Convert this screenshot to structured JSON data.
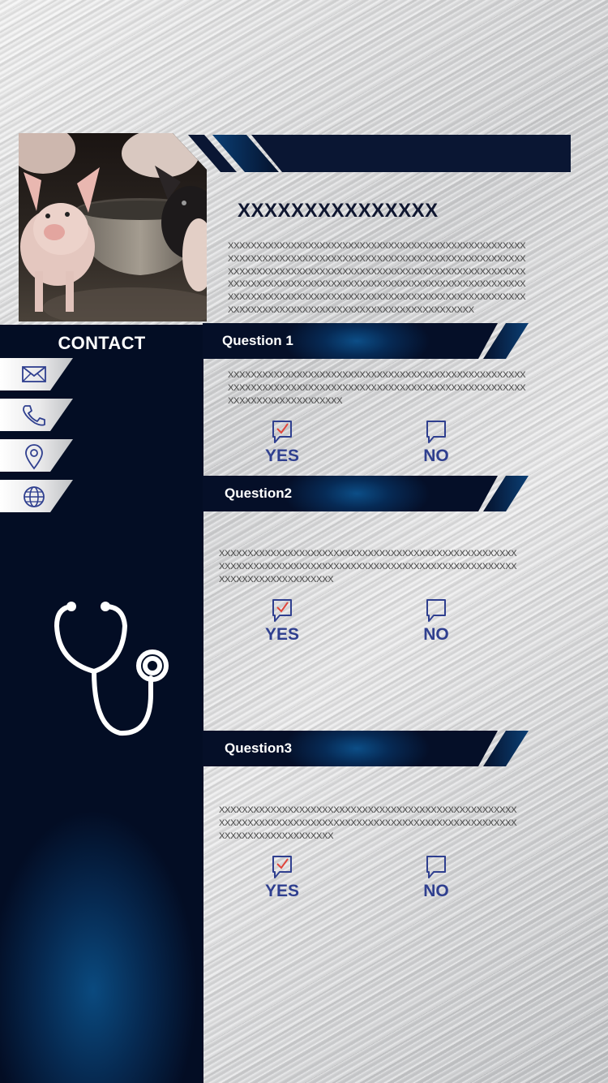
{
  "profile": {
    "name": "XXXXXXXXXXXXXXX",
    "bio": "XXXXXXXXXXXXXXXXXXXXXXXXXXXXXXXXXXXXXXXXXXXXXXXXXXXXXXXXXXXXXXXXXXXXXXXXXXXXXXXXXXXXXXXXXXXXXXXXXXXXXXXXXXXXXXXXXXXXXXXXXXXXXXXXXXXXXXXXXXXXXXXXXXXXXXXXXXXXXXXXXXXXXXXXXXXXXXXXXXXXXXXXXXXXXXXXXXXXXXXXXXXXXXXXXXXXXXXXXXXXXXXXXXXXXXXXXXXXXXXXXXXXXXXXXXXXXXXXXXXXXXXXXXXXXXXXXXXXXXXXXXXXXXXXXXXXXXXXXXXXXXX"
  },
  "contact": {
    "title": "CONTACT",
    "items": [
      {
        "icon": "mail-icon"
      },
      {
        "icon": "phone-icon"
      },
      {
        "icon": "location-icon"
      },
      {
        "icon": "globe-icon"
      }
    ]
  },
  "questions": [
    {
      "label": "Question 1",
      "text": "XXXXXXXXXXXXXXXXXXXXXXXXXXXXXXXXXXXXXXXXXXXXXXXXXXXXXXXXXXXXXXXXXXXXXXXXXXXXXXXXXXXXXXXXXXXXXXXXXXXXXXXXXXXXXXXXXXXXXXXXXXXX",
      "yes": "YES",
      "no": "NO"
    },
    {
      "label": "Question2",
      "text": "XXXXXXXXXXXXXXXXXXXXXXXXXXXXXXXXXXXXXXXXXXXXXXXXXXXXXXXXXXXXXXXXXXXXXXXXXXXXXXXXXXXXXXXXXXXXXXXXXXXXXXXXXXXXXXXXXXXXXXXXXXXX",
      "yes": "YES",
      "no": "NO"
    },
    {
      "label": "Question3",
      "text": "XXXXXXXXXXXXXXXXXXXXXXXXXXXXXXXXXXXXXXXXXXXXXXXXXXXXXXXXXXXXXXXXXXXXXXXXXXXXXXXXXXXXXXXXXXXXXXXXXXXXXXXXXXXXXXXXXXXXXXXXXXXX",
      "yes": "YES",
      "no": "NO"
    }
  ],
  "colors": {
    "navy": "#050f28",
    "accent": "#2f3f8f",
    "check": "#e0463c"
  }
}
